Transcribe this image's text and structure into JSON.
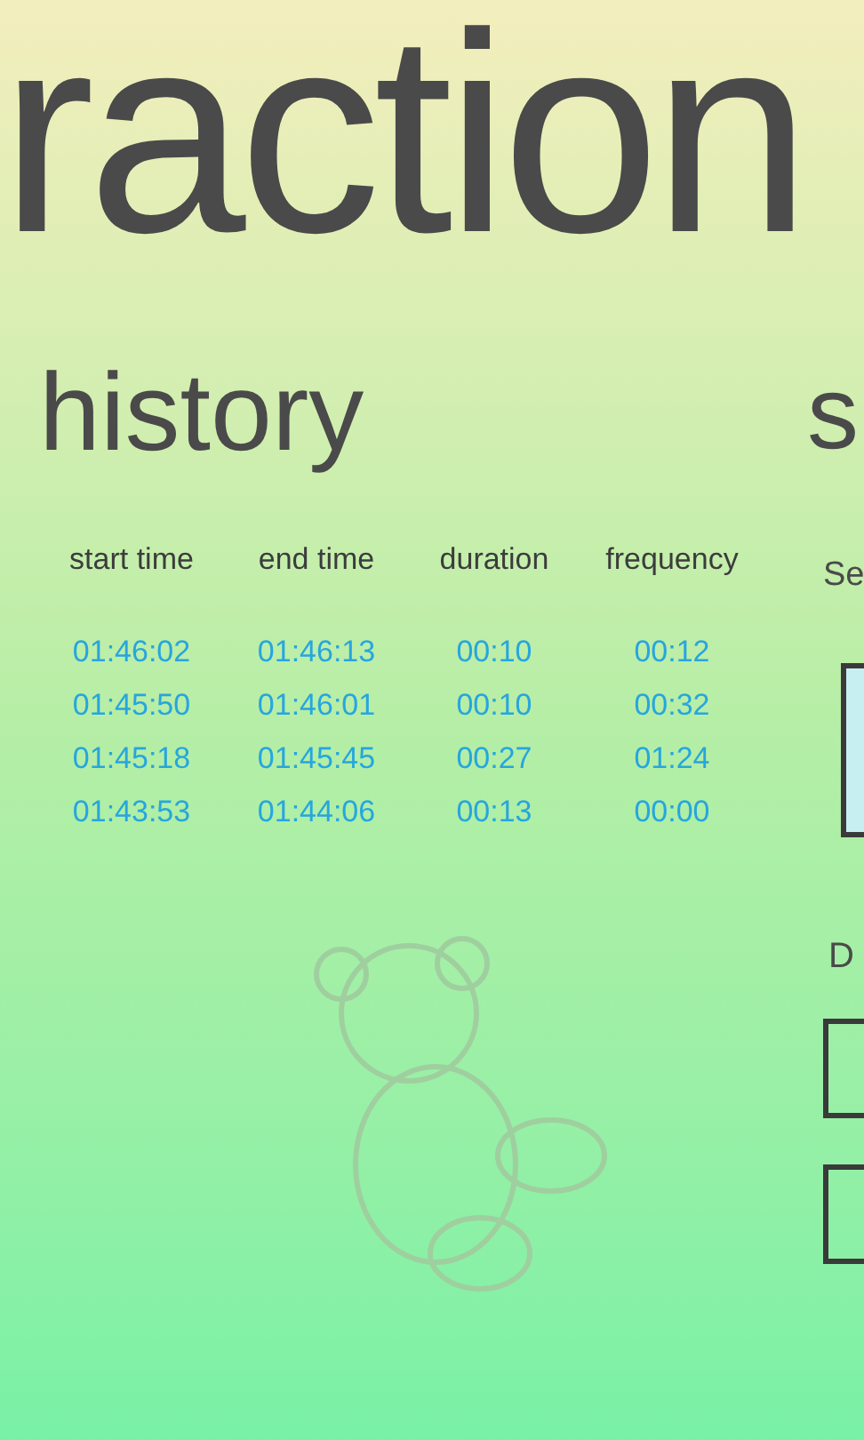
{
  "panorama_title": "raction",
  "history": {
    "title": "history",
    "columns": [
      "start time",
      "end time",
      "duration",
      "frequency"
    ],
    "rows": [
      [
        "01:46:02",
        "01:46:13",
        "00:10",
        "00:12"
      ],
      [
        "01:45:50",
        "01:46:01",
        "00:10",
        "00:32"
      ],
      [
        "01:45:18",
        "01:45:45",
        "00:27",
        "01:24"
      ],
      [
        "01:43:53",
        "01:44:06",
        "00:13",
        "00:00"
      ]
    ]
  },
  "next_section": {
    "title": "s",
    "label_1": "Se",
    "label_2": "D"
  }
}
